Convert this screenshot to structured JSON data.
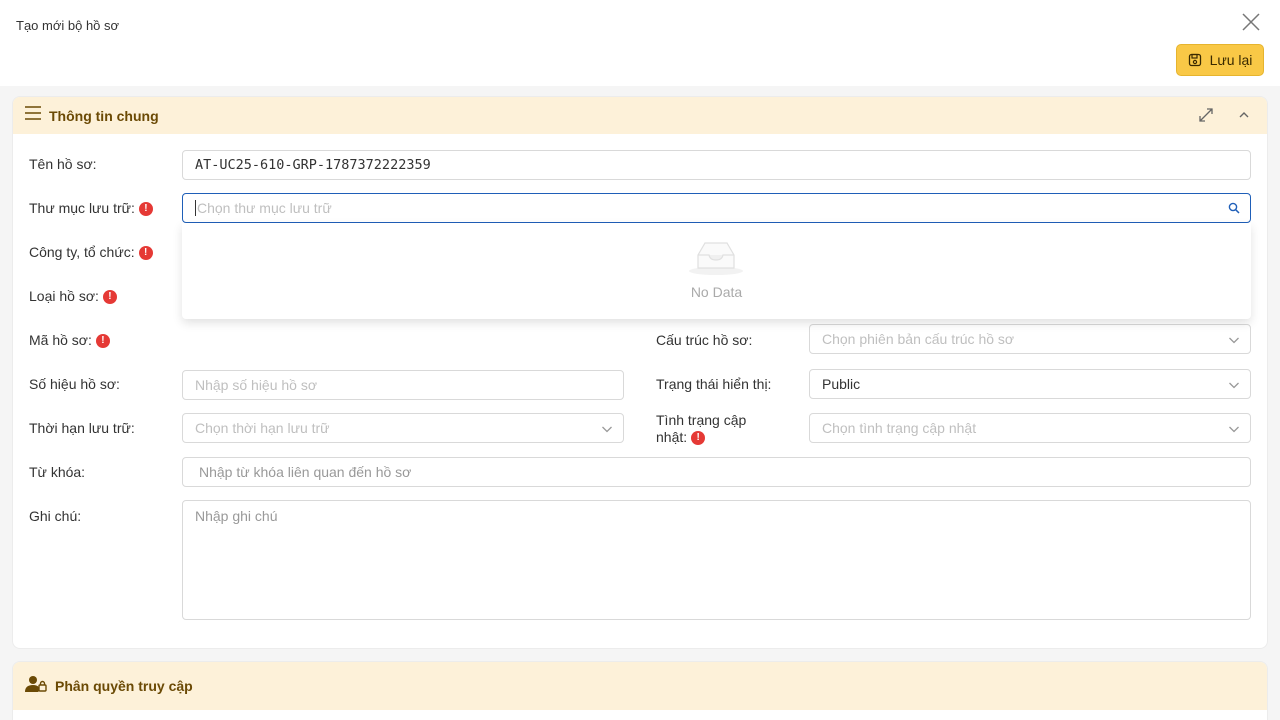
{
  "header": {
    "title": "Tạo mới bộ hồ sơ",
    "save_label": "Lưu lại"
  },
  "section_general": {
    "title": "Thông tin chung",
    "fields": {
      "name": {
        "label": "Tên hồ sơ:",
        "value": "AT-UC25-610-GRP-1787372222359"
      },
      "folder": {
        "label": "Thư mục lưu trữ:",
        "placeholder": "Chọn thư mục lưu trữ",
        "required": true
      },
      "company": {
        "label": "Công ty, tổ chức:",
        "required": true
      },
      "type": {
        "label": "Loại hồ sơ:",
        "required": true
      },
      "code": {
        "label": "Mã hồ sơ:",
        "required": true
      },
      "structure": {
        "label": "Cấu trúc hồ sơ:",
        "placeholder": "Chọn phiên bản cấu trúc hồ sơ"
      },
      "number": {
        "label": "Số hiệu hồ sơ:",
        "placeholder": "Nhập số hiệu hồ sơ"
      },
      "visibility": {
        "label": "Trạng thái hiển thị:",
        "value": "Public"
      },
      "retention": {
        "label": "Thời hạn lưu trữ:",
        "placeholder": "Chọn thời hạn lưu trữ"
      },
      "update_status": {
        "label_line1": "Tình trạng cập",
        "label_line2": "nhật:",
        "placeholder": "Chọn tình trạng cập nhật",
        "required": true
      },
      "keywords": {
        "label": "Từ khóa:",
        "placeholder": "Nhập từ khóa liên quan đến hồ sơ"
      },
      "notes": {
        "label": "Ghi chú:",
        "placeholder": "Nhập ghi chú"
      }
    },
    "dropdown": {
      "empty_text": "No Data"
    }
  },
  "section_access": {
    "title": "Phân quyền truy cập"
  },
  "colors": {
    "accent": "#f9c846",
    "header_bg": "#fdf1d9",
    "header_text": "#6b4a05",
    "required": "#e53935",
    "focus_border": "#1f5fb8"
  },
  "icons": [
    "close-icon",
    "save-icon",
    "menu-icon",
    "expand-icon",
    "chevron-up-icon",
    "search-icon",
    "chevron-down-icon",
    "empty-inbox-icon",
    "user-lock-icon",
    "required-icon"
  ]
}
